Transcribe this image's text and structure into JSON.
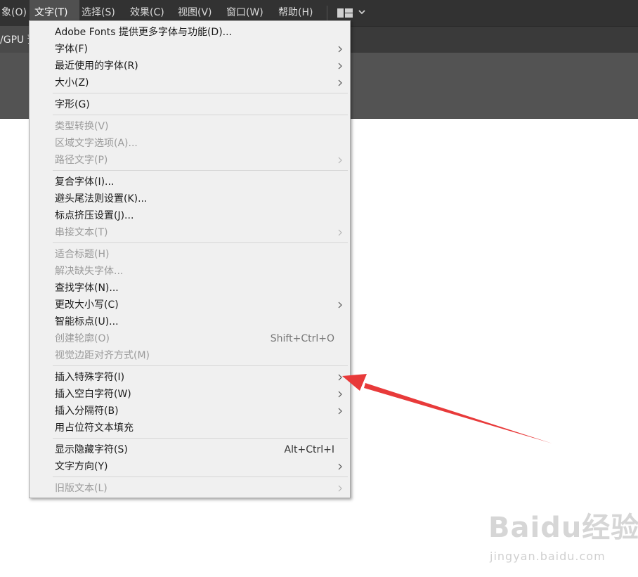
{
  "menubar": {
    "items": [
      {
        "label": "象(O)"
      },
      {
        "label": "文字(T)"
      },
      {
        "label": "选择(S)"
      },
      {
        "label": "效果(C)"
      },
      {
        "label": "视图(V)"
      },
      {
        "label": "窗口(W)"
      },
      {
        "label": "帮助(H)"
      }
    ]
  },
  "document_tab": {
    "label": "/GPU 预"
  },
  "type_menu": {
    "items": [
      {
        "label": "Adobe Fonts 提供更多字体与功能(D)..."
      },
      {
        "label": "字体(F)"
      },
      {
        "label": "最近使用的字体(R)"
      },
      {
        "label": "大小(Z)"
      },
      {
        "label": "字形(G)"
      },
      {
        "label": "类型转换(V)"
      },
      {
        "label": "区域文字选项(A)..."
      },
      {
        "label": "路径文字(P)"
      },
      {
        "label": "复合字体(I)..."
      },
      {
        "label": "避头尾法则设置(K)..."
      },
      {
        "label": "标点挤压设置(J)..."
      },
      {
        "label": "串接文本(T)"
      },
      {
        "label": "适合标题(H)"
      },
      {
        "label": "解决缺失字体..."
      },
      {
        "label": "查找字体(N)..."
      },
      {
        "label": "更改大小写(C)"
      },
      {
        "label": "智能标点(U)..."
      },
      {
        "label": "创建轮廓(O)",
        "shortcut": "Shift+Ctrl+O"
      },
      {
        "label": "视觉边距对齐方式(M)"
      },
      {
        "label": "插入特殊字符(I)"
      },
      {
        "label": "插入空白字符(W)"
      },
      {
        "label": "插入分隔符(B)"
      },
      {
        "label": "用占位符文本填充"
      },
      {
        "label": "显示隐藏字符(S)",
        "shortcut": "Alt+Ctrl+I"
      },
      {
        "label": "文字方向(Y)"
      },
      {
        "label": "旧版文本(L)"
      }
    ]
  },
  "annotation": {
    "color": "#e83a3a"
  },
  "watermark": {
    "logo": "Baidu经验",
    "url": "jingyan.baidu.com"
  },
  "colors": {
    "menubar_bg": "#323232",
    "menu_bg": "#f0f0f0",
    "disabled_text": "#9a9a9a",
    "arrow_red": "#e83a3a"
  }
}
